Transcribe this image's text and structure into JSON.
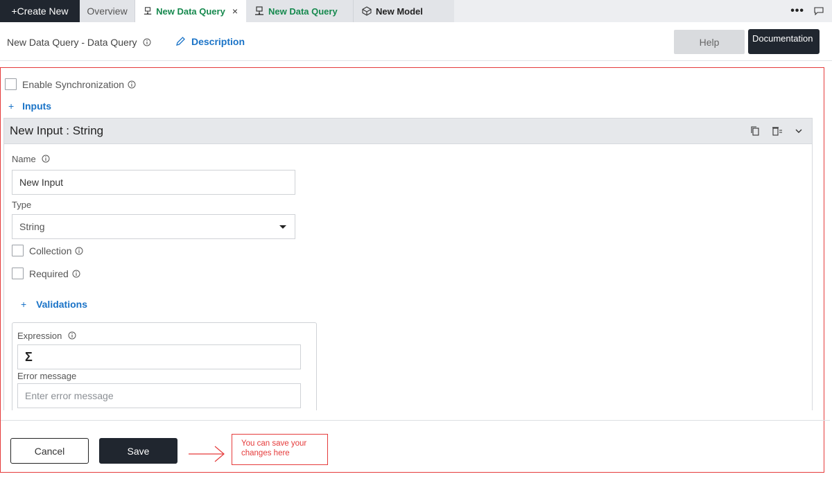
{
  "tabs": {
    "create_new": "+Create New",
    "overview": "Overview",
    "data_query_active": "New Data Query",
    "data_query_active_close": "×",
    "data_query_second": "New Data Query",
    "new_model": "New Model",
    "more": "•••"
  },
  "header": {
    "title": "New Data Query - Data Query",
    "description_link": "Description",
    "help_button": "Help",
    "documentation_button": "Documentation"
  },
  "form": {
    "enable_sync_label": "Enable Synchronization",
    "enable_sync_checked": false,
    "inputs_link_plus": "+",
    "inputs_link": "Inputs",
    "input_card": {
      "title": "New Input : String",
      "name_label": "Name",
      "name_value": "New Input",
      "type_label": "Type",
      "type_value": "String",
      "collection_label": "Collection",
      "collection_checked": false,
      "required_label": "Required",
      "required_checked": false,
      "validations_plus": "+",
      "validations_link": "Validations",
      "validation": {
        "expression_label": "Expression",
        "expression_symbol": "Σ",
        "error_message_label": "Error message",
        "error_message_placeholder": "Enter error message"
      }
    }
  },
  "footer": {
    "cancel_button": "Cancel",
    "save_button": "Save"
  },
  "annotation": {
    "callout_text": "You can save your changes here",
    "color": "#e53a3a"
  },
  "colors": {
    "dark": "#20262f",
    "link_blue": "#1a73c7",
    "tab_green": "#16894e"
  }
}
